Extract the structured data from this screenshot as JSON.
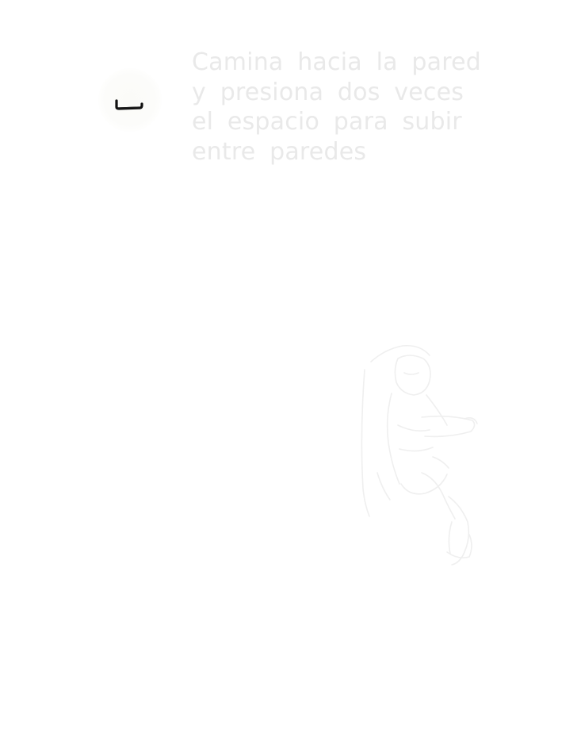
{
  "tutorial": {
    "icon": "space-bar-icon",
    "instruction_lines": [
      "Camina hacia la pared",
      "y presiona dos veces",
      "el espacio para subir",
      "entre paredes"
    ]
  },
  "illustration": {
    "icon": "wall-climbing-character-sketch"
  },
  "colors": {
    "background": "#ffffff",
    "instruction_text": "#e9e9e9",
    "key_icon": "#111111",
    "sketch_stroke": "#efefef"
  }
}
